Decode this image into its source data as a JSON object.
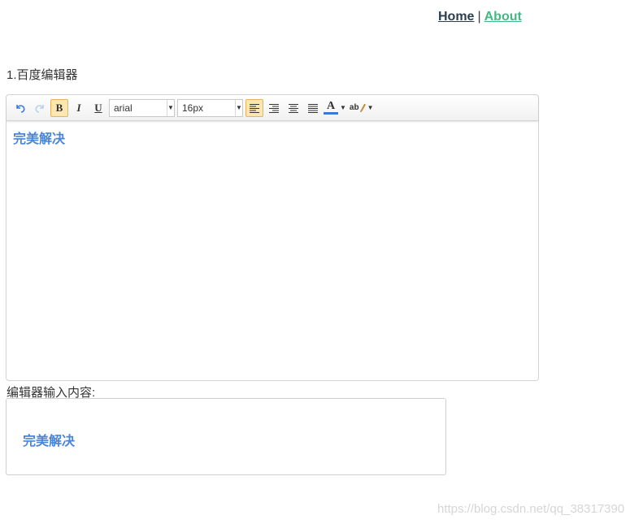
{
  "nav": {
    "home_label": "Home",
    "separator": "|",
    "about_label": "About",
    "home_color": "#2c3e50",
    "about_color": "#42b983"
  },
  "section_title": "1.百度编辑器",
  "toolbar": {
    "buttons": [
      {
        "name": "undo-icon",
        "active": false
      },
      {
        "name": "redo-icon",
        "active": false
      },
      {
        "name": "bold-button",
        "label": "B",
        "active": true
      },
      {
        "name": "italic-button",
        "label": "I",
        "active": false
      },
      {
        "name": "underline-button",
        "label": "U",
        "active": false
      }
    ],
    "font_family": "arial",
    "font_size": "16px",
    "align_left_active": true,
    "font_color_label": "A",
    "highlight_label": "ab"
  },
  "editor": {
    "content": "完美解决",
    "content_color": "#4a86d6"
  },
  "output": {
    "label": "编辑器输入内容:",
    "content": "完美解决"
  },
  "watermark": "https://blog.csdn.net/qq_38317390"
}
